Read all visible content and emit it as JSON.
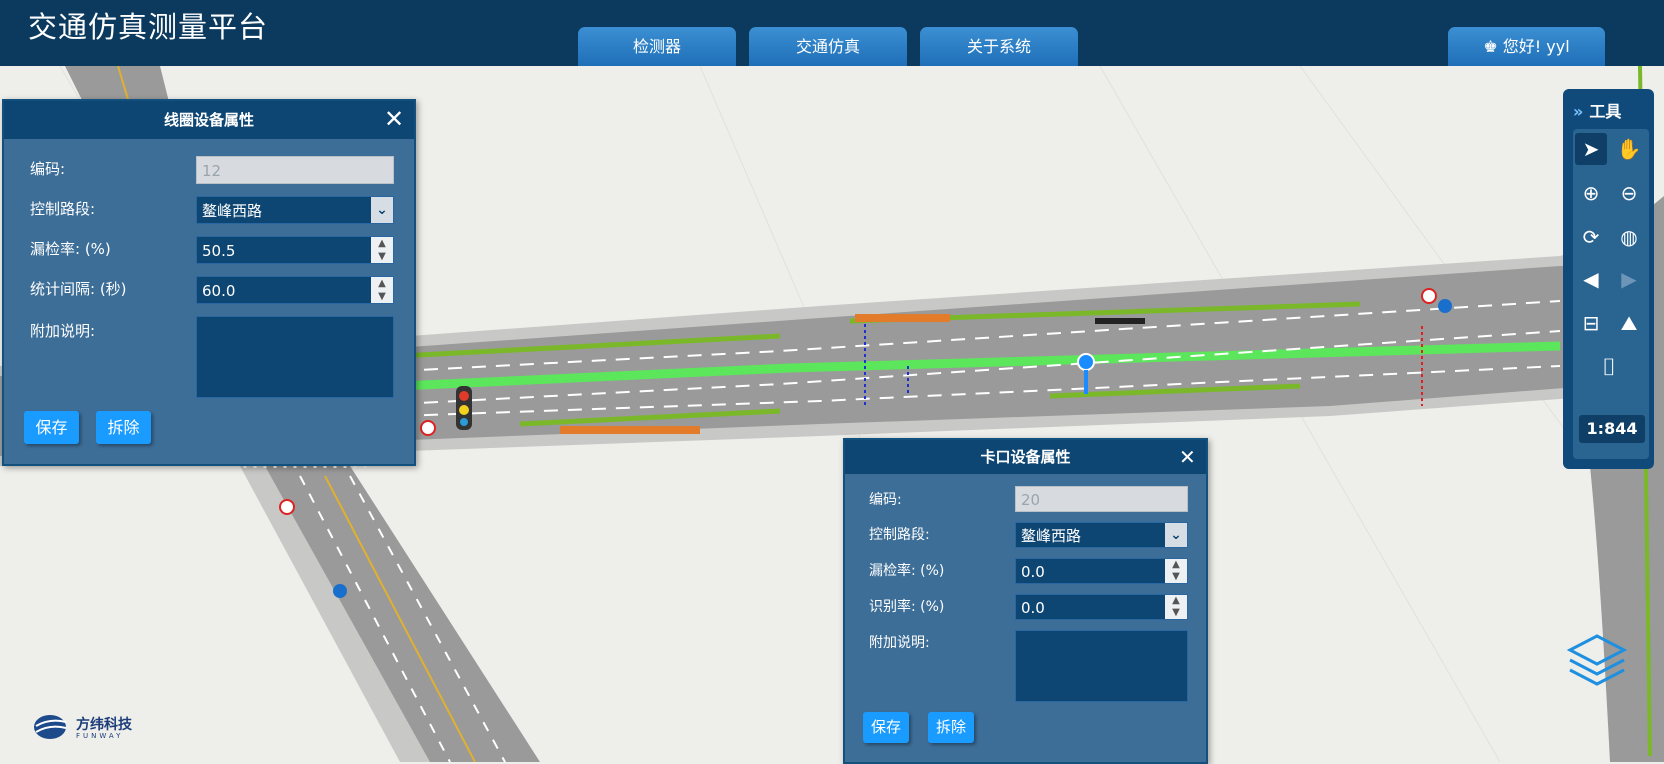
{
  "app_title": "交通仿真测量平台",
  "nav": {
    "tabs": [
      "检测器",
      "交通仿真",
      "关于系统"
    ]
  },
  "user": {
    "label": "您好! yyl"
  },
  "loop_panel": {
    "title": "线圈设备属性",
    "code_label": "编码:",
    "code_value": "12",
    "road_label": "控制路段:",
    "road_value": "鳌峰西路",
    "miss_label": "漏检率: (%)",
    "miss_value": "50.5",
    "interval_label": "统计间隔: (秒)",
    "interval_value": "60.0",
    "note_label": "附加说明:",
    "save_label": "保存",
    "remove_label": "拆除",
    "close_icon": "close-icon"
  },
  "checkpoint_panel": {
    "title": "卡口设备属性",
    "code_label": "编码:",
    "code_value": "20",
    "road_label": "控制路段:",
    "road_value": "鳌峰西路",
    "miss_label": "漏检率: (%)",
    "miss_value": "0.0",
    "recog_label": "识别率: (%)",
    "recog_value": "0.0",
    "note_label": "附加说明:",
    "save_label": "保存",
    "remove_label": "拆除",
    "close_icon": "close-icon"
  },
  "tools": {
    "title": "工具",
    "icons": [
      "pointer-icon",
      "pan-hand-icon",
      "zoom-in-icon",
      "zoom-out-icon",
      "refresh-icon",
      "globe-icon",
      "back-icon",
      "forward-icon",
      "measure-icon",
      "landscape-icon",
      "camera-icon"
    ],
    "scale": "1:844"
  },
  "logo": {
    "name": "方纬科技",
    "sub": "FUNWAY"
  },
  "colors": {
    "header": "#0c3a5e",
    "panel": "#3d6e98",
    "panel_header": "#0e4673",
    "button": "#1a9bff",
    "map": "#eeeeea"
  }
}
